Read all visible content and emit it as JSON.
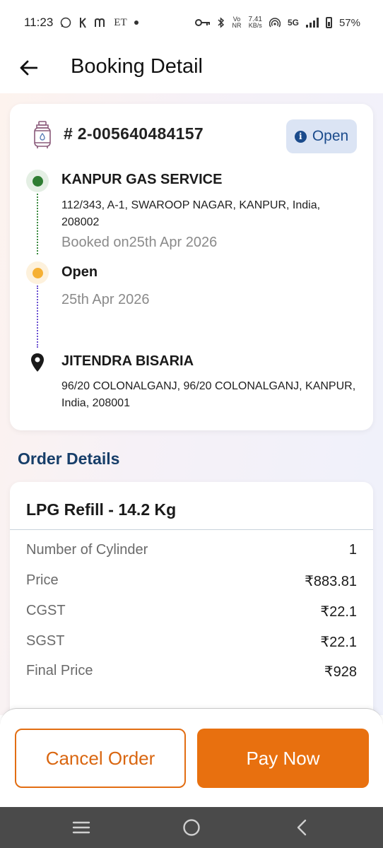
{
  "status_bar": {
    "time": "11:23",
    "et_label": "ET",
    "network_speed": "7.41",
    "network_speed_unit": "KB/s",
    "network_type": "5G",
    "volte": "Vo",
    "nr": "NR",
    "battery": "57%"
  },
  "header": {
    "title": "Booking Detail"
  },
  "booking": {
    "number": "# 2-005640484157",
    "status": "Open",
    "distributor_name": "KANPUR GAS SERVICE",
    "distributor_address": "112/343, A-1, SWAROOP NAGAR, KANPUR, India, 208002",
    "booked_on": "Booked on25th Apr 2026",
    "current_status": "Open",
    "status_date": "25th Apr 2026",
    "customer_name": "JITENDRA BISARIA",
    "customer_address": "96/20 COLONALGANJ, 96/20 COLONALGANJ, KANPUR, India, 208001"
  },
  "order_details": {
    "section_title": "Order Details",
    "product": "LPG Refill - 14.2 Kg",
    "rows": [
      {
        "label": "Number of Cylinder",
        "value": "1"
      },
      {
        "label": "Price",
        "value": "₹883.81"
      },
      {
        "label": "CGST",
        "value": "₹22.1"
      },
      {
        "label": "SGST",
        "value": "₹22.1"
      },
      {
        "label": "Final Price",
        "value": "₹928"
      }
    ]
  },
  "actions": {
    "cancel_label": "Cancel Order",
    "pay_label": "Pay Now"
  },
  "colors": {
    "accent_orange": "#e8700f",
    "status_blue": "#1b4b8c",
    "section_title": "#173e69",
    "timeline_green": "#2e7d32",
    "timeline_yellow": "#f5b034"
  }
}
